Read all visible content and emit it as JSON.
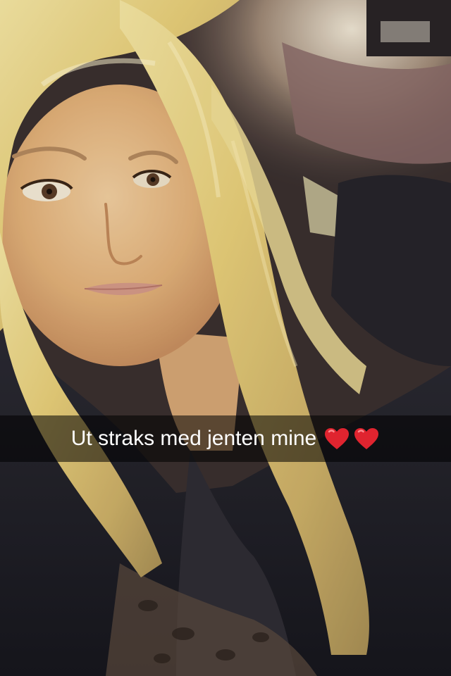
{
  "snap": {
    "caption": "Ut straks med jenten mine",
    "caption_emojis": [
      "red-heart-icon",
      "red-heart-icon"
    ],
    "heart_color": "#e0242f",
    "caption_bar_color": "rgba(0,0,0,0.55)"
  }
}
